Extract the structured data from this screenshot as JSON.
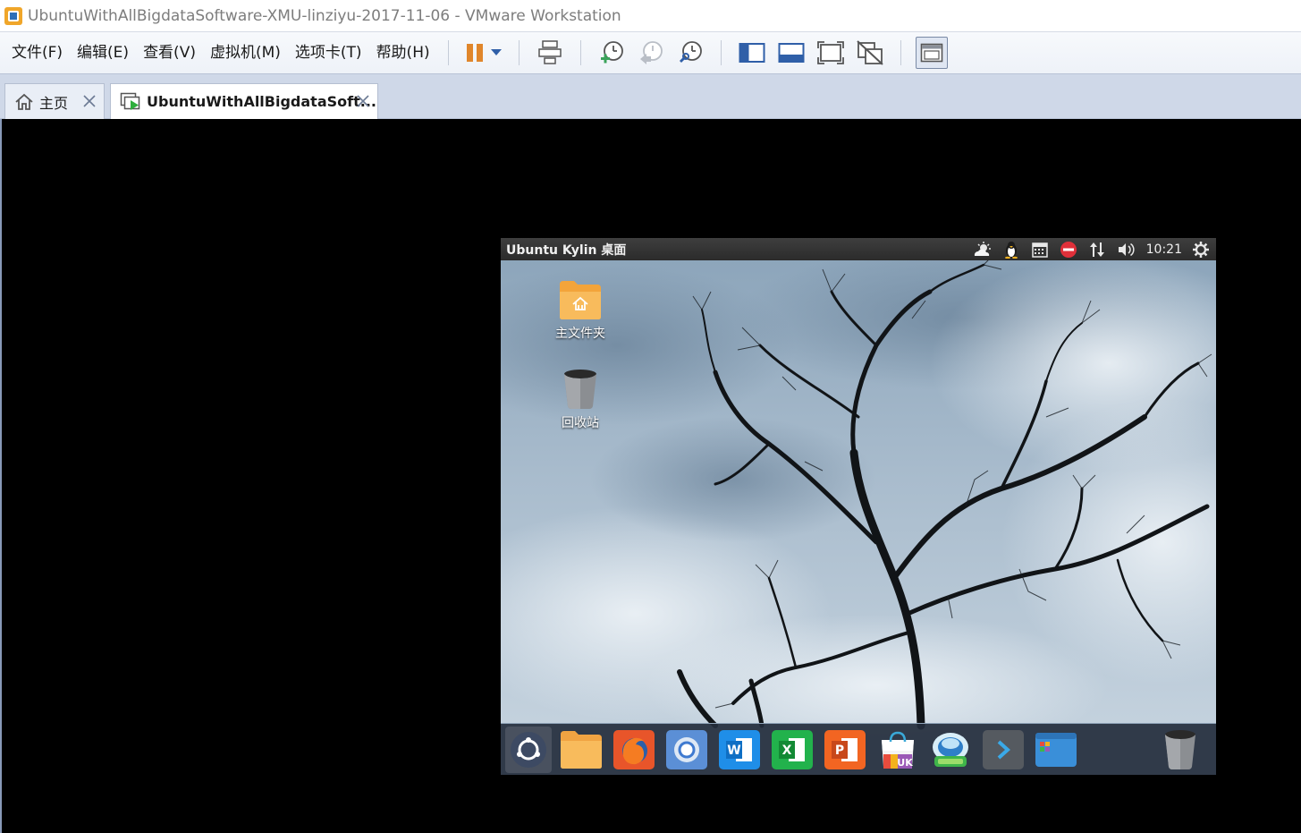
{
  "window": {
    "title": "UbuntuWithAllBigdataSoftware-XMU-linziyu-2017-11-06 - VMware Workstation"
  },
  "menu": {
    "items": [
      "文件(F)",
      "编辑(E)",
      "查看(V)",
      "虚拟机(M)",
      "选项卡(T)",
      "帮助(H)"
    ]
  },
  "toolbar": {
    "buttons": [
      {
        "name": "pause-icon"
      },
      {
        "name": "dropdown-arrow-icon"
      },
      {
        "name": "send-ctrl-alt-del-icon"
      },
      {
        "name": "take-snapshot-icon"
      },
      {
        "name": "revert-snapshot-icon"
      },
      {
        "name": "snapshot-manager-icon"
      },
      {
        "name": "show-library-icon"
      },
      {
        "name": "thumbnail-bar-icon"
      },
      {
        "name": "full-screen-icon"
      },
      {
        "name": "unity-mode-icon"
      },
      {
        "name": "console-view-icon"
      }
    ]
  },
  "tabs": [
    {
      "label": "主页",
      "icon": "home-icon"
    },
    {
      "label": "UbuntuWithAllBigdataSoft...",
      "icon": "vm-running-icon"
    }
  ],
  "guest": {
    "panel_title": "Ubuntu Kylin 桌面",
    "clock": "10:21",
    "indicators": [
      "weather-icon",
      "penguin-icon",
      "calendar-icon",
      "do-not-disturb-icon",
      "network-icon",
      "volume-icon"
    ],
    "desktop_icons": [
      {
        "label": "主文件夹",
        "icon": "home-folder-icon"
      },
      {
        "label": "回收站",
        "icon": "trash-icon"
      }
    ],
    "dock": [
      {
        "name": "dash-home-icon",
        "color": "#3d4a63"
      },
      {
        "name": "files-icon",
        "color": "#f5a742"
      },
      {
        "name": "firefox-icon",
        "color": "#e8552a"
      },
      {
        "name": "chromium-icon",
        "color": "#5b8fd6"
      },
      {
        "name": "wps-writer-icon",
        "color": "#1f8ee8"
      },
      {
        "name": "wps-spreadsheets-icon",
        "color": "#22b24c"
      },
      {
        "name": "wps-presentation-icon",
        "color": "#f26522"
      },
      {
        "name": "ubuntu-kylin-software-center-icon",
        "color": "#ffffff"
      },
      {
        "name": "kylin-assistant-icon",
        "color": "#7fc6e8"
      },
      {
        "name": "terminal-icon",
        "color": "#555a60"
      },
      {
        "name": "workspace-switcher-icon",
        "color": "#3a8fd9"
      }
    ]
  }
}
